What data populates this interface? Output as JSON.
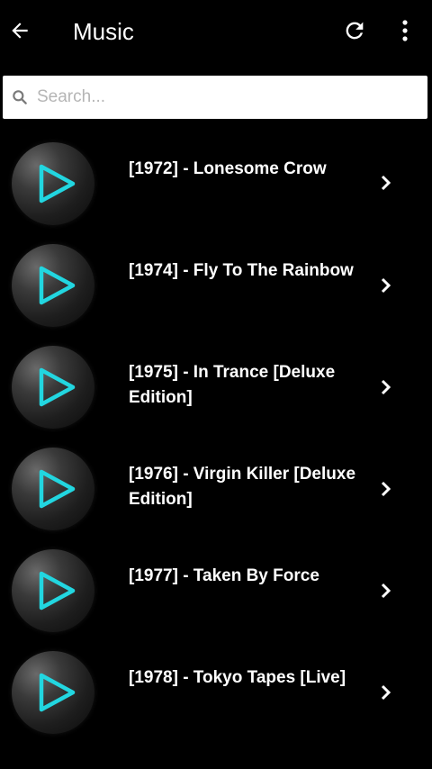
{
  "toolbar": {
    "title": "Music",
    "back_icon": "arrow-left-icon",
    "refresh_icon": "refresh-icon",
    "more_icon": "more-vertical-icon"
  },
  "search": {
    "placeholder": "Search...",
    "value": ""
  },
  "colors": {
    "background": "#000000",
    "accent": "#22d6e0",
    "text": "#ffffff"
  },
  "albums": [
    {
      "label": "[1972] - Lonesome Crow"
    },
    {
      "label": "[1974] - Fly To The Rainbow"
    },
    {
      "label": "[1975] - In Trance [Deluxe Edition]"
    },
    {
      "label": "[1976] - Virgin Killer [Deluxe Edition]"
    },
    {
      "label": "[1977] - Taken By Force"
    },
    {
      "label": "[1978] - Tokyo Tapes [Live]"
    }
  ]
}
